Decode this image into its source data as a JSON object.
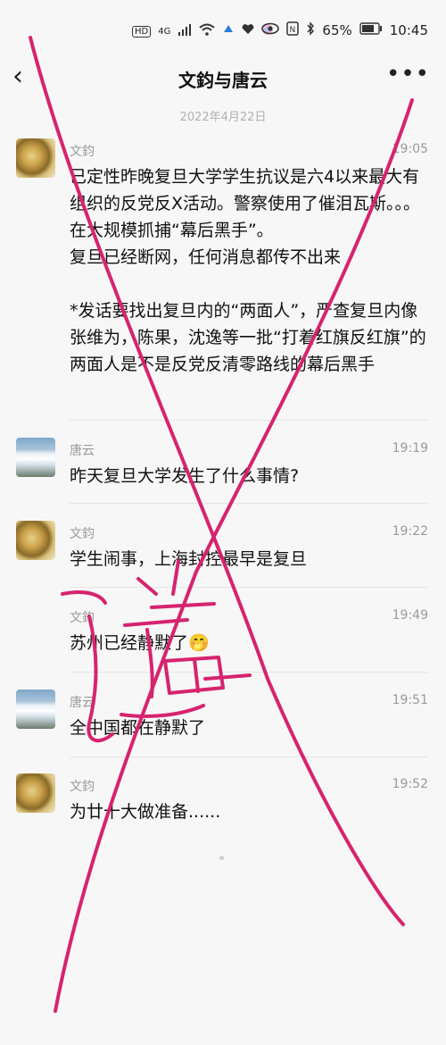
{
  "status_bar": {
    "left_icons": [
      "HD",
      "4G",
      "signal",
      "wifi",
      "app-icon-1",
      "app-icon-2",
      "app-icon-3"
    ],
    "battery": "65%",
    "time": "10:45"
  },
  "header": {
    "title": "文鈞与唐云"
  },
  "date_label": "2022年4月22日",
  "messages": [
    {
      "sender": "文鈞",
      "time": "19:05",
      "avatar": "snake",
      "text": "已定性昨晚复旦大学学生抗议是六4以来最大有组织的反党反X活动。警察使用了催泪瓦斯。。。在大规模抓捕“幕后黑手”。\n复旦已经断网，任何消息都传不出来\n\n*发话要找出复旦内的“两面人”，严查复旦内像张维为，陈果，沈逸等一批“打着红旗反红旗”的两面人是不是反党反清零路线的幕后黑手"
    },
    {
      "sender": "唐云",
      "time": "19:19",
      "avatar": "waterfall",
      "text": "昨天复旦大学发生了什么事情?"
    },
    {
      "sender": "文鈞",
      "time": "19:22",
      "avatar": "snake",
      "text": "学生闹事，上海封控最早是复旦"
    },
    {
      "sender": "文鈞",
      "time": "19:49",
      "avatar": "none",
      "text": "苏州已经静默了🤭"
    },
    {
      "sender": "唐云",
      "time": "19:51",
      "avatar": "waterfall",
      "text": "全中国都在静默了"
    },
    {
      "sender": "文鈞",
      "time": "19:52",
      "avatar": "snake",
      "text": "为廿十大做准备......"
    }
  ],
  "annotation": {
    "color": "#d6246e",
    "handwritten_text": "谣"
  }
}
